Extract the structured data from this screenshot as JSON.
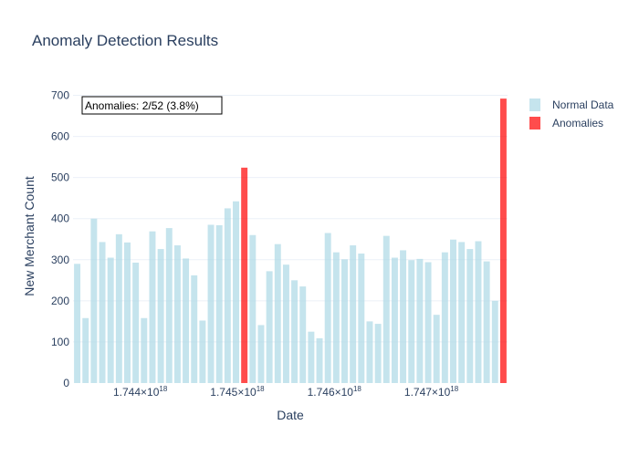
{
  "chart_data": {
    "type": "bar",
    "title": "Anomaly Detection Results",
    "xlabel": "Date",
    "ylabel": "New Merchant Count",
    "ylim": [
      0,
      710
    ],
    "y_ticks": [
      0,
      100,
      200,
      300,
      400,
      500,
      600,
      700
    ],
    "x_ticks": [
      {
        "value": 1.744,
        "label": "1.744×10"
      },
      {
        "value": 1.745,
        "label": "1.745×10"
      },
      {
        "value": 1.746,
        "label": "1.746×10"
      },
      {
        "value": 1.747,
        "label": "1.747×10"
      }
    ],
    "x_tick_exponent": "18",
    "grid": true,
    "legend_position": "top-right",
    "annotation": "Anomalies: 2/52 (3.8%)",
    "series": [
      {
        "name": "Normal Data",
        "color": "#add8e6",
        "values": [
          290,
          158,
          400,
          343,
          305,
          362,
          342,
          293,
          158,
          369,
          326,
          377,
          335,
          303,
          262,
          152,
          385,
          384,
          425,
          442,
          null,
          360,
          141,
          272,
          338,
          288,
          250,
          235,
          125,
          109,
          365,
          318,
          301,
          335,
          315,
          150,
          144,
          358,
          305,
          323,
          299,
          302,
          294,
          166,
          318,
          349,
          343,
          326,
          345,
          296,
          200,
          null
        ]
      },
      {
        "name": "Anomalies",
        "color": "#ff0000",
        "values": [
          null,
          null,
          null,
          null,
          null,
          null,
          null,
          null,
          null,
          null,
          null,
          null,
          null,
          null,
          null,
          null,
          null,
          null,
          null,
          null,
          524,
          null,
          null,
          null,
          null,
          null,
          null,
          null,
          null,
          null,
          null,
          null,
          null,
          null,
          null,
          null,
          null,
          null,
          null,
          null,
          null,
          null,
          null,
          null,
          null,
          null,
          null,
          null,
          null,
          null,
          null,
          692
        ]
      }
    ]
  }
}
